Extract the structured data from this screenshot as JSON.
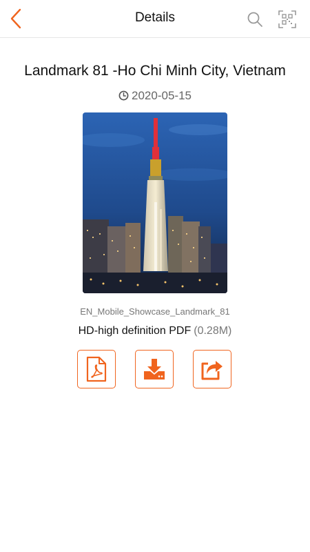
{
  "header": {
    "title": "Details",
    "back_icon": "chevron-left-icon",
    "search_icon": "search-icon",
    "scan_icon": "qr-scan-icon"
  },
  "document": {
    "title": "Landmark 81 -Ho Chi Minh City, Vietnam",
    "date": "2020-05-15",
    "file_name": "EN_Mobile_Showcase_Landmark_81",
    "format_label": "HD-high definition PDF",
    "file_size": "(0.28M)"
  },
  "actions": [
    {
      "icon": "pdf-file-icon"
    },
    {
      "icon": "download-icon"
    },
    {
      "icon": "share-icon"
    }
  ],
  "colors": {
    "accent": "#f0641e",
    "text_primary": "#111111",
    "text_secondary": "#666666"
  }
}
